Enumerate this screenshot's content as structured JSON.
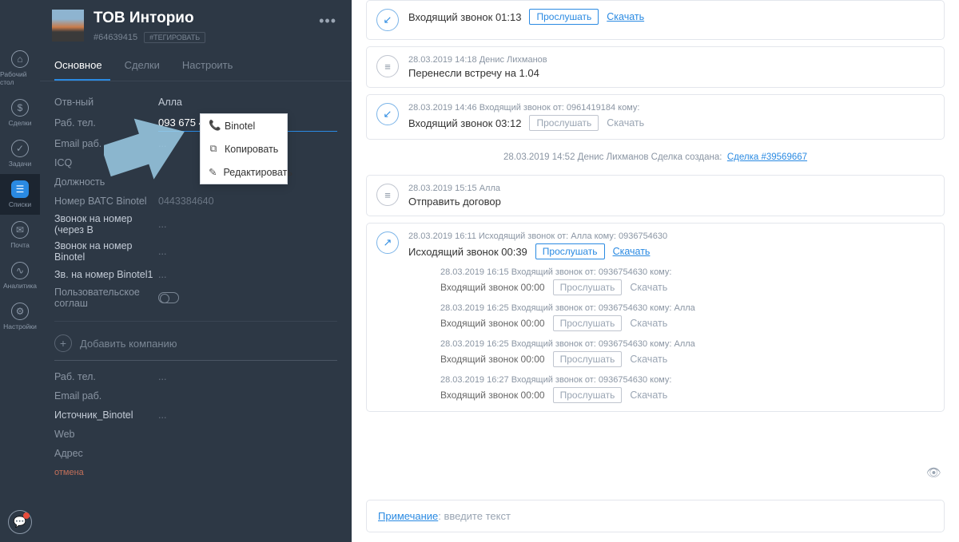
{
  "nav": {
    "items": [
      {
        "label": "Рабочий стол"
      },
      {
        "label": "Сделки"
      },
      {
        "label": "Задачи"
      },
      {
        "label": "Списки"
      },
      {
        "label": "Почта"
      },
      {
        "label": "Аналитика"
      },
      {
        "label": "Настройки"
      }
    ]
  },
  "card": {
    "title": "ТОВ Инторио",
    "id": "#64639415",
    "tag_btn": "#ТЕГИРОВАТЬ",
    "tabs": {
      "main": "Основное",
      "deals": "Сделки",
      "setup": "Настроить"
    },
    "fields": {
      "resp_label": "Отв-ный",
      "resp_value": "Алла",
      "phone_label": "Раб. тел.",
      "phone_value": "093 675 4630",
      "email_label": "Email раб.",
      "email_value": "...",
      "icq_label": "ICQ",
      "position_label": "Должность",
      "vats_label": "Номер ВАТС Binotel",
      "vats_value": "0443384640",
      "call_b_label": "Звонок на номер (через B",
      "call_b_value": "...",
      "call_bin_label": "Звонок на номер Binotel",
      "call_bin_value": "...",
      "call_bin1_label": "Зв. на номер Binotel1",
      "call_bin1_value": "...",
      "consent_label": "Пользовательское соглаш"
    },
    "cancel": "отмена",
    "add_company": "Добавить компанию",
    "company_fields": {
      "phone_label": "Раб. тел.",
      "phone_value": "...",
      "email_label": "Email раб.",
      "src_label": "Источник_Binotel",
      "src_value": "...",
      "web_label": "Web",
      "addr_label": "Адрес"
    },
    "ctx": {
      "binotel": "Binotel",
      "copy": "Копировать",
      "edit": "Редактировать"
    }
  },
  "feed": {
    "e0": {
      "title": "Входящий звонок 01:13",
      "listen": "Прослушать",
      "download": "Скачать"
    },
    "e1": {
      "meta": "28.03.2019 14:18 Денис Лихманов",
      "title": "Перенесли встречу на 1.04"
    },
    "e2": {
      "meta": "28.03.2019 14:46 Входящий звонок от: 0961419184 кому:",
      "title": "Входящий звонок 03:12",
      "listen": "Прослушать",
      "download": "Скачать"
    },
    "sys": {
      "meta": "28.03.2019 14:52 Денис Лихманов  Сделка создана:",
      "link": "Сделка #39569667"
    },
    "e3": {
      "meta": "28.03.2019 15:15 Алла",
      "title": "Отправить договор"
    },
    "e4": {
      "meta": "28.03.2019 16:11 Исходящий звонок от: Алла кому: 0936754630",
      "title": "Исходящий звонок 00:39",
      "listen": "Прослушать",
      "download": "Скачать",
      "s1": {
        "meta": "28.03.2019 16:15 Входящий звонок от: 0936754630 кому:",
        "title": "Входящий звонок 00:00",
        "listen": "Прослушать",
        "download": "Скачать"
      },
      "s2": {
        "meta": "28.03.2019 16:25 Входящий звонок от: 0936754630 кому: Алла",
        "title": "Входящий звонок 00:00",
        "listen": "Прослушать",
        "download": "Скачать"
      },
      "s3": {
        "meta": "28.03.2019 16:25 Входящий звонок от: 0936754630 кому: Алла",
        "title": "Входящий звонок 00:00",
        "listen": "Прослушать",
        "download": "Скачать"
      },
      "s4": {
        "meta": "28.03.2019 16:27 Входящий звонок от: 0936754630 кому:",
        "title": "Входящий звонок 00:00",
        "listen": "Прослушать",
        "download": "Скачать"
      }
    },
    "note": {
      "prefix": "Примечание",
      "placeholder": ": введите текст"
    }
  }
}
